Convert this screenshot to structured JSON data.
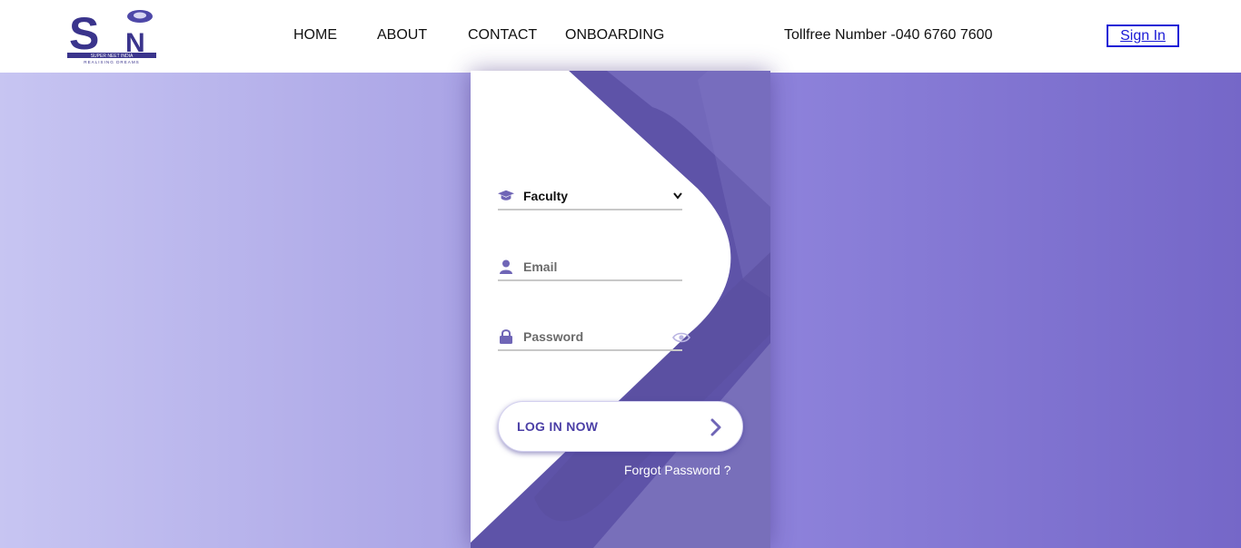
{
  "brand": {
    "logo_letters": "SN",
    "logo_tagline": "SUPER NEET INDIA",
    "logo_subtagline": "REALISING DREAMS"
  },
  "nav": {
    "items": [
      {
        "label": "HOME"
      },
      {
        "label": "ABOUT"
      },
      {
        "label": "CONTACT"
      },
      {
        "label": "ONBOARDING"
      }
    ]
  },
  "header": {
    "tollfree": "Tollfree Number -040 6760 7600",
    "signin_label": "Sign In"
  },
  "login": {
    "role_select": {
      "value": "Faculty",
      "icon": "graduation-cap-icon"
    },
    "email": {
      "placeholder": "Email",
      "icon": "user-icon"
    },
    "password": {
      "placeholder": "Password",
      "icon": "lock-icon",
      "toggle_icon": "eye-icon"
    },
    "submit_label": "LOG IN NOW",
    "forgot_label": "Forgot Password ?"
  },
  "colors": {
    "accent": "#5b4fa6",
    "accent_light": "#7c72c8",
    "signin_blue": "#1a1ad6"
  }
}
